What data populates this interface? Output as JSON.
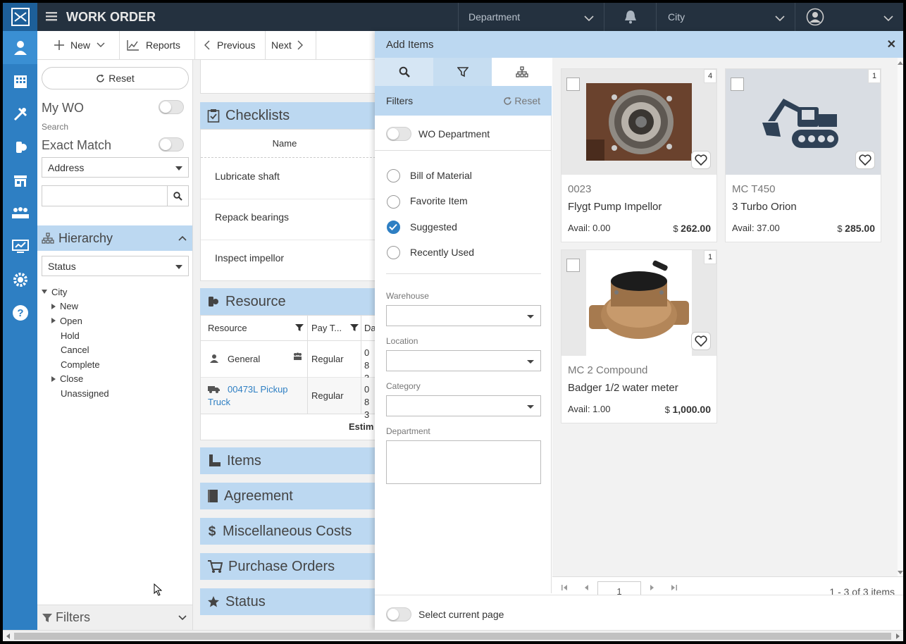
{
  "app": {
    "title": "WORK ORDER"
  },
  "topbar": {
    "department": "Department",
    "city": "City"
  },
  "toolbar": {
    "new_label": "New",
    "reports_label": "Reports",
    "previous_label": "Previous",
    "next_label": "Next"
  },
  "left": {
    "reset_label": "Reset",
    "my_wo_label": "My WO",
    "search_label": "Search",
    "exact_match_label": "Exact Match",
    "field_select": "Address",
    "search_value": "",
    "hierarchy_label": "Hierarchy",
    "status_select": "Status",
    "tree": {
      "root": "City",
      "items": [
        "New",
        "Open",
        "Hold",
        "Cancel",
        "Complete",
        "Close",
        "Unassigned"
      ]
    },
    "filters_label": "Filters"
  },
  "main": {
    "checklists_label": "Checklists",
    "checklist_name_header": "Name",
    "checklist_items": [
      "Lubricate shaft",
      "Repack bearings",
      "Inspect impellor"
    ],
    "resource_label": "Resource",
    "resource_headers": [
      "Resource",
      "Pay T...",
      "Da"
    ],
    "resource_rows": [
      {
        "name": "General",
        "pay": "Regular",
        "date": "08 3"
      },
      {
        "name": "00473L Pickup Truck",
        "pay": "Regular",
        "date": "08 3"
      }
    ],
    "estimate_label": "Estim",
    "sections": [
      "Items",
      "Agreement",
      "Miscellaneous Costs",
      "Purchase Orders",
      "Status"
    ]
  },
  "add_items": {
    "title": "Add Items",
    "filters_label": "Filters",
    "reset_label": "Reset",
    "wo_department_label": "WO Department",
    "options": [
      "Bill of Material",
      "Favorite Item",
      "Suggested",
      "Recently Used"
    ],
    "selected_option": "Suggested",
    "warehouse_label": "Warehouse",
    "location_label": "Location",
    "category_label": "Category",
    "department_label": "Department",
    "warehouse_value": "",
    "location_value": "",
    "category_value": "",
    "department_value": "",
    "items": [
      {
        "qty": "4",
        "code": "0023",
        "name": "Flygt Pump Impellor",
        "avail": "Avail: 0.00",
        "currency": "$",
        "price": "262.00"
      },
      {
        "qty": "1",
        "code": "MC T450",
        "name": "3 Turbo Orion",
        "avail": "Avail: 37.00",
        "currency": "$",
        "price": "285.00"
      },
      {
        "qty": "1",
        "code": "MC 2 Compound",
        "name": "Badger 1/2 water meter",
        "avail": "Avail: 1.00",
        "currency": "$",
        "price": "1,000.00"
      }
    ],
    "page_number": "1",
    "pager_summary": "1 - 3 of 3 items",
    "select_page_label": "Select current page"
  },
  "colors": {
    "rail": "#2e7fc3",
    "topbar": "#24313f",
    "section": "#bcd8f1",
    "check": "#2e7fc3"
  }
}
